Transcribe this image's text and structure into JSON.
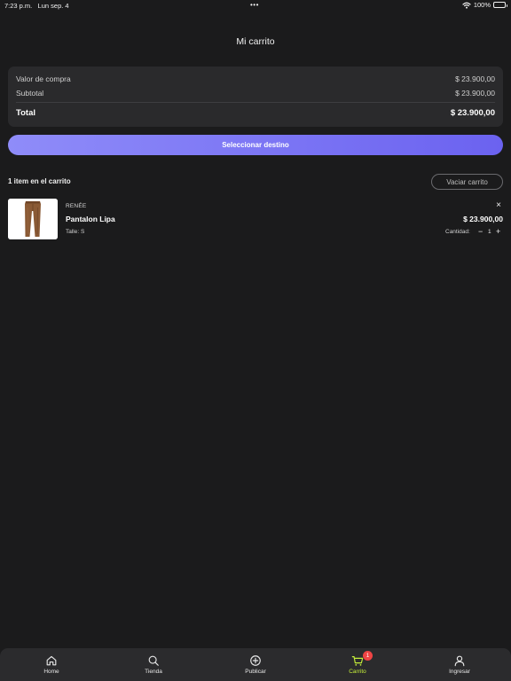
{
  "status_bar": {
    "time": "7:23 p.m.",
    "date": "Lun sep. 4",
    "dots": "•••",
    "battery": "100%"
  },
  "header": {
    "title": "Mi carrito"
  },
  "summary": {
    "valor_label": "Valor de compra",
    "valor_value": "$ 23.900,00",
    "subtotal_label": "Subtotal",
    "subtotal_value": "$ 23.900,00",
    "total_label": "Total",
    "total_value": "$ 23.900,00"
  },
  "actions": {
    "destino_label": "Seleccionar destino",
    "vaciar_label": "Vaciar carrito"
  },
  "cart": {
    "count_label": "1 item en el carrito",
    "items": [
      {
        "brand": "RENÉE",
        "name": "Pantalon Lipa",
        "size_label": "Talle: S",
        "price": "$ 23.900,00",
        "qty_label": "Cantidad:",
        "qty": "1",
        "remove": "×",
        "minus": "−",
        "plus": "+"
      }
    ]
  },
  "tab_bar": {
    "tabs": [
      {
        "label": "Home",
        "icon": "home-icon"
      },
      {
        "label": "Tienda",
        "icon": "search-icon"
      },
      {
        "label": "Publicar",
        "icon": "plus-circle-icon"
      },
      {
        "label": "Carrito",
        "icon": "cart-icon",
        "badge": "1",
        "active": true
      },
      {
        "label": "Ingresar",
        "icon": "user-icon"
      }
    ]
  },
  "colors": {
    "background": "#1b1b1c",
    "card": "#2a2a2c",
    "accent_start": "#8f8cf9",
    "accent_end": "#6b62f0",
    "active_tab": "#c6f03a",
    "badge": "#ef4444"
  }
}
